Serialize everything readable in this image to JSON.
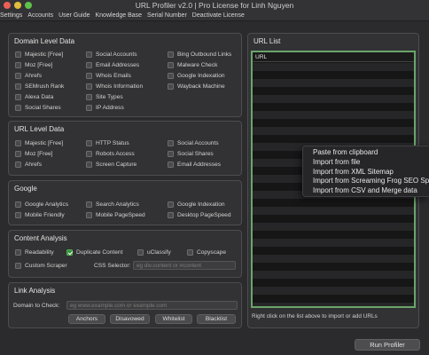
{
  "window": {
    "title": "URL Profiler v2.0 | Pro License for Linh Nguyen"
  },
  "menu": [
    "Settings",
    "Accounts",
    "User Guide",
    "Knowledge Base",
    "Serial Number",
    "Deactivate License"
  ],
  "domain_level": {
    "title": "Domain Level Data",
    "items": [
      "Majestic [Free]",
      "Social Accounts",
      "Bing Outbound Links",
      "Moz [Free]",
      "Email Addresses",
      "Malware Check",
      "Ahrefs",
      "Whois Emails",
      "Google Indexation",
      "SEMrush Rank",
      "Whois Information",
      "Wayback Machine",
      "Alexa Data",
      "Site Types",
      "Social Shares",
      "IP Address"
    ]
  },
  "url_level": {
    "title": "URL Level Data",
    "items": [
      "Majestic [Free]",
      "HTTP Status",
      "Social Accounts",
      "Moz [Free]",
      "Robots Access",
      "Social Shares",
      "Ahrefs",
      "Screen Capture",
      "Email Addresses"
    ]
  },
  "google": {
    "title": "Google",
    "items": [
      "Google Analytics",
      "Search Analytics",
      "Google Indexation",
      "Mobile Friendly",
      "Mobile PageSpeed",
      "Desktop PageSpeed"
    ]
  },
  "content_analysis": {
    "title": "Content Analysis",
    "items": [
      "Readability",
      "Duplicate Content",
      "uClassify",
      "Copyscape",
      "Custom Scraper"
    ],
    "checked": [
      false,
      true,
      false,
      false,
      false
    ],
    "css_selector_label": "CSS Selector:",
    "css_selector_placeholder": "eg div.content or #content"
  },
  "link_analysis": {
    "title": "Link Analysis",
    "domain_label": "Domain to Check:",
    "domain_placeholder": "eg www.example.com or example.com",
    "buttons": [
      "Anchors",
      "Disavowed",
      "Whitelist",
      "Blacklist"
    ]
  },
  "url_list": {
    "title": "URL List",
    "column_header": "URL",
    "hint": "Right click on the list above to import or add URLs"
  },
  "context_menu": [
    "Paste from clipboard",
    "Import from file",
    "Import from XML Sitemap",
    "Import from Screaming Frog SEO Spider",
    "Import from CSV and Merge data"
  ],
  "run_button": "Run Profiler",
  "colors": {
    "background": "#2b2b2d",
    "panel": "#323234",
    "accent_green": "#6aa56a",
    "checked_green": "#3a8f3b"
  }
}
